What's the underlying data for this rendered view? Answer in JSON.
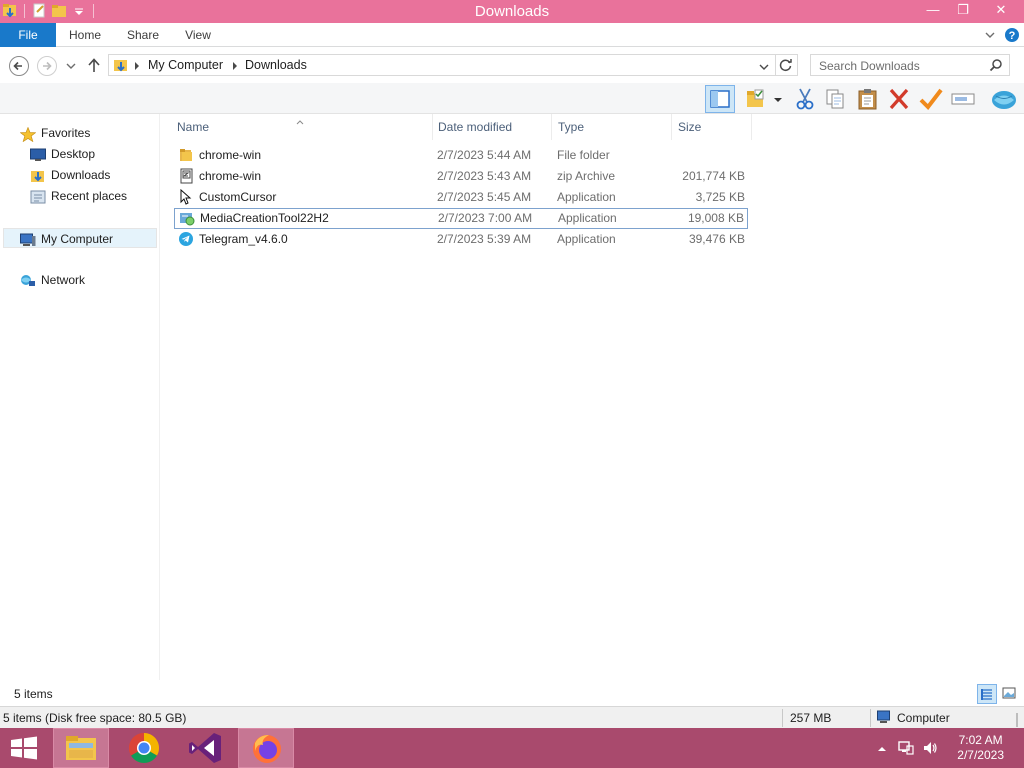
{
  "window": {
    "title": "Downloads",
    "title_bar_color": "#e9729b",
    "minimize_glyph": "—",
    "restore_glyph": "❐",
    "close_glyph": "✕"
  },
  "ribbon": {
    "tabs": [
      {
        "label": "File"
      },
      {
        "label": "Home"
      },
      {
        "label": "Share"
      },
      {
        "label": "View"
      }
    ],
    "file_tab_color": "#1979ca"
  },
  "address": {
    "crumbs": [
      "My Computer",
      "Downloads"
    ],
    "search_placeholder": "Search Downloads"
  },
  "navigation": {
    "favorites_label": "Favorites",
    "favorites": [
      {
        "label": "Desktop",
        "icon": "desktop-icon"
      },
      {
        "label": "Downloads",
        "icon": "downloads-folder-icon"
      },
      {
        "label": "Recent places",
        "icon": "recent-places-icon"
      }
    ],
    "computer_label": "My Computer",
    "network_label": "Network"
  },
  "columns": {
    "name": "Name",
    "date": "Date modified",
    "type": "Type",
    "size": "Size"
  },
  "files": [
    {
      "name": "chrome-win",
      "date": "2/7/2023 5:44 AM",
      "type": "File folder",
      "size": "",
      "icon": "folder-icon"
    },
    {
      "name": "chrome-win",
      "date": "2/7/2023 5:43 AM",
      "type": "zip Archive",
      "size": "201,774 KB",
      "icon": "zip-icon"
    },
    {
      "name": "CustomCursor",
      "date": "2/7/2023 5:45 AM",
      "type": "Application",
      "size": "3,725 KB",
      "icon": "cursor-app-icon"
    },
    {
      "name": "MediaCreationTool22H2",
      "date": "2/7/2023 7:00 AM",
      "type": "Application",
      "size": "19,008 KB",
      "icon": "media-tool-icon"
    },
    {
      "name": "Telegram_v4.6.0",
      "date": "2/7/2023 5:39 AM",
      "type": "Application",
      "size": "39,476 KB",
      "icon": "telegram-icon"
    }
  ],
  "status": {
    "item_count": "5 items",
    "details": "5 items (Disk free space: 80.5 GB)",
    "size_total": "257 MB",
    "location": "Computer"
  },
  "taskbar": {
    "time": "7:02 AM",
    "date": "2/7/2023",
    "color": "#a94a6d"
  }
}
